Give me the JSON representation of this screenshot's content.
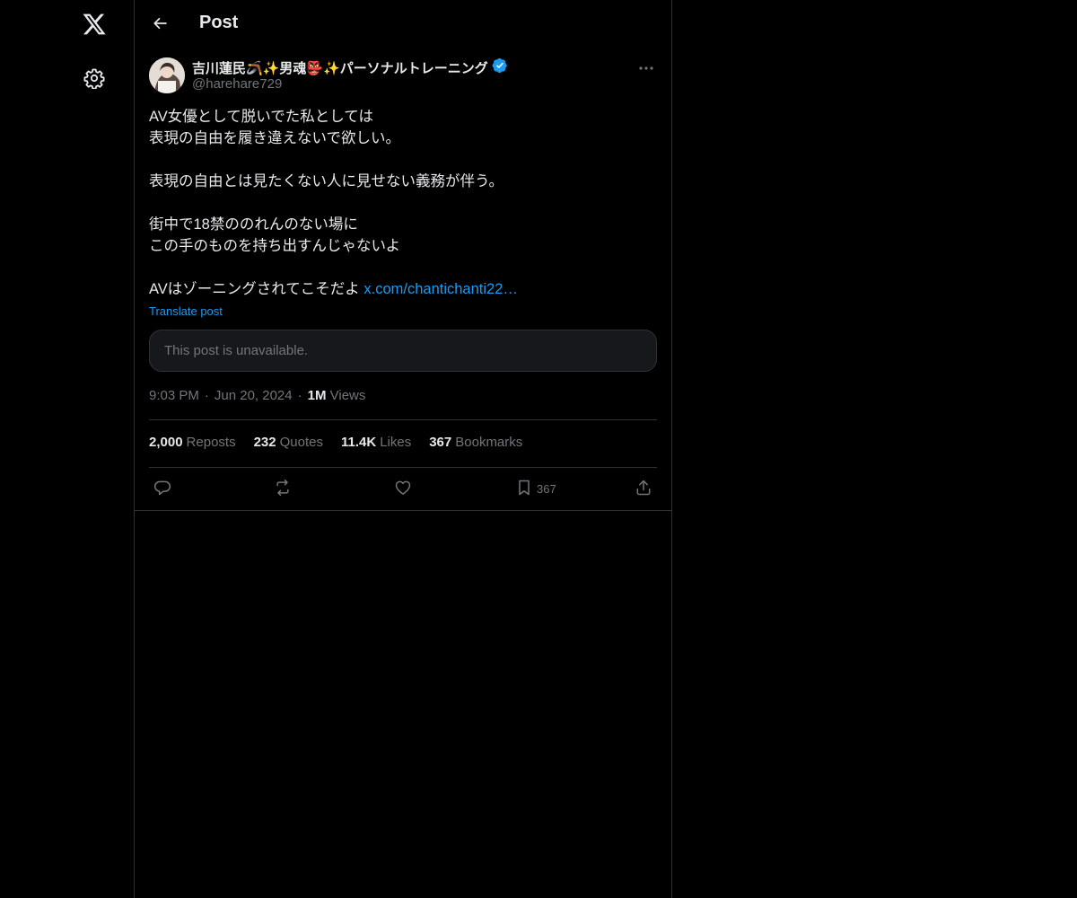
{
  "topbar": {
    "title": "Post"
  },
  "author": {
    "name": "吉川蓮民🪃✨男魂👺✨パーソナルトレーニング",
    "handle": "@harehare729",
    "verified": true
  },
  "post": {
    "text": "AV女優として脱いでた私としては\n表現の自由を履き違えないで欲しい。\n\n表現の自由とは見たくない人に見せない義務が伴う。\n\n街中で18禁ののれんのない場に\nこの手のものを持ち出すんじゃないよ\n\nAVはゾーニングされてこそだよ ",
    "link_text": "x.com/chantichanti22…",
    "translate_label": "Translate post",
    "quoted_unavailable": "This post is unavailable."
  },
  "meta": {
    "time": "9:03 PM",
    "date": "Jun 20, 2024",
    "views_count": "1M",
    "views_label": " Views"
  },
  "stats": {
    "reposts_count": "2,000",
    "reposts_label": "Reposts",
    "quotes_count": "232",
    "quotes_label": "Quotes",
    "likes_count": "11.4K",
    "likes_label": "Likes",
    "bookmarks_count": "367",
    "bookmarks_label": "Bookmarks"
  },
  "actions": {
    "bookmark_count": "367"
  },
  "colors": {
    "background": "#000000",
    "accent": "#1d9bf0",
    "muted": "#71767b",
    "text": "#e7e9ea",
    "border": "#2f3336"
  }
}
